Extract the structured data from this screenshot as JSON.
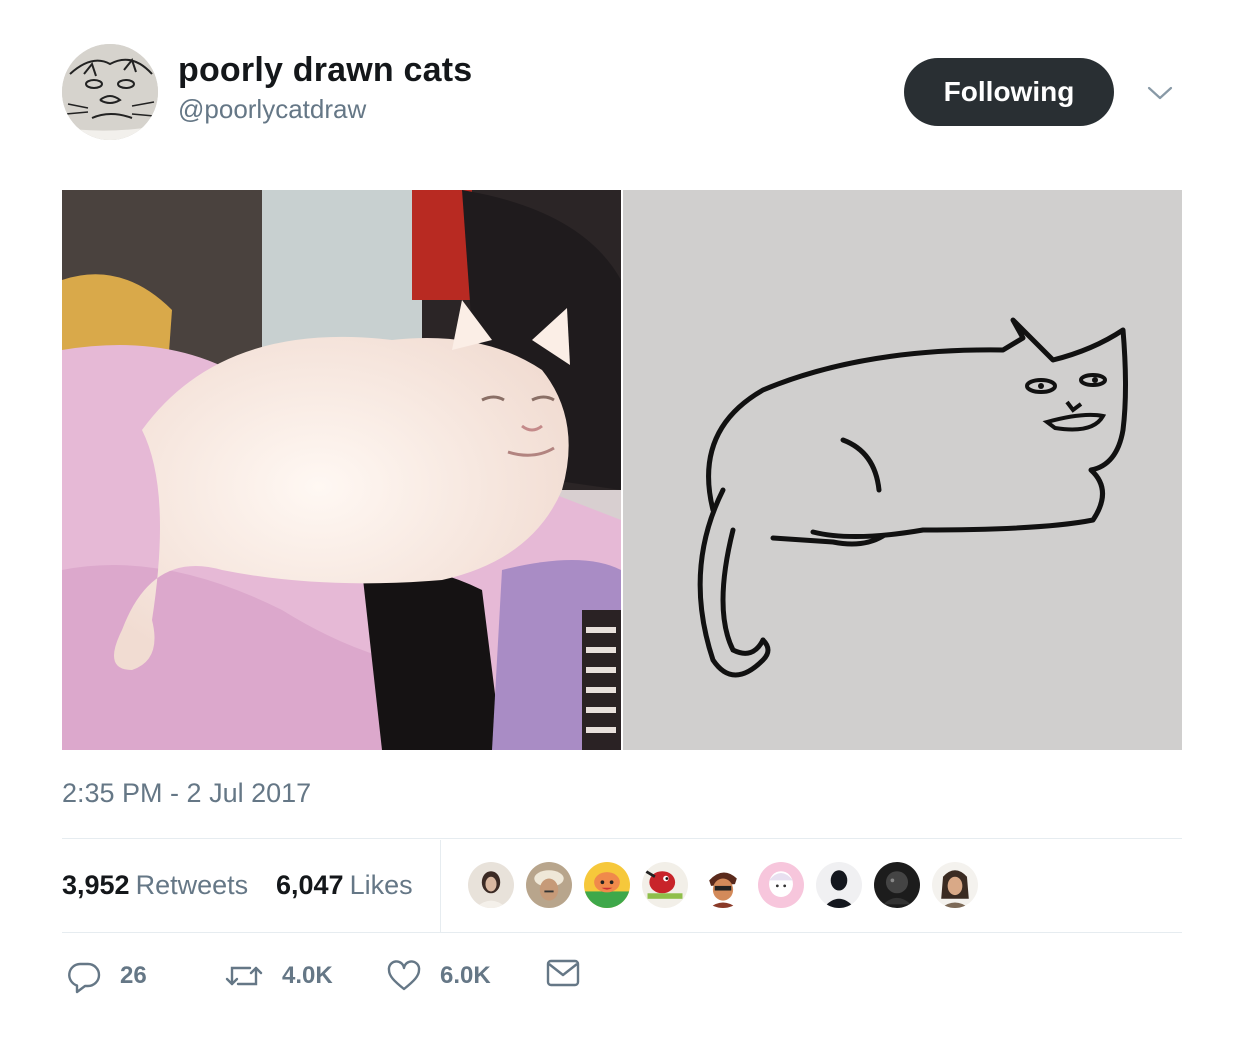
{
  "author": {
    "display_name": "poorly drawn cats",
    "handle": "@poorlycatdraw",
    "avatar_icon": "cat-sketch-avatar"
  },
  "follow_button": {
    "label": "Following"
  },
  "caret_icon": "chevron-down-icon",
  "media": [
    {
      "alt_icon": "white-cat-photo"
    },
    {
      "alt_icon": "cat-line-drawing"
    }
  ],
  "timestamp": "2:35 PM - 2 Jul 2017",
  "stats": {
    "retweets": {
      "count": "3,952",
      "label": "Retweets"
    },
    "likes": {
      "count": "6,047",
      "label": "Likes"
    }
  },
  "likers": [
    "liker-avatar-1",
    "liker-avatar-2",
    "liker-avatar-3",
    "liker-avatar-4",
    "liker-avatar-5",
    "liker-avatar-6",
    "liker-avatar-7",
    "liker-avatar-8",
    "liker-avatar-9"
  ],
  "actions": {
    "reply": {
      "count": "26",
      "icon": "reply-icon"
    },
    "retweet": {
      "count": "4.0K",
      "icon": "retweet-icon"
    },
    "like": {
      "count": "6.0K",
      "icon": "heart-icon"
    },
    "message": {
      "icon": "envelope-icon"
    }
  },
  "colors": {
    "text_primary": "#14171a",
    "text_secondary": "#657786",
    "button_dark": "#292f33",
    "divider": "#e6ecf0"
  }
}
